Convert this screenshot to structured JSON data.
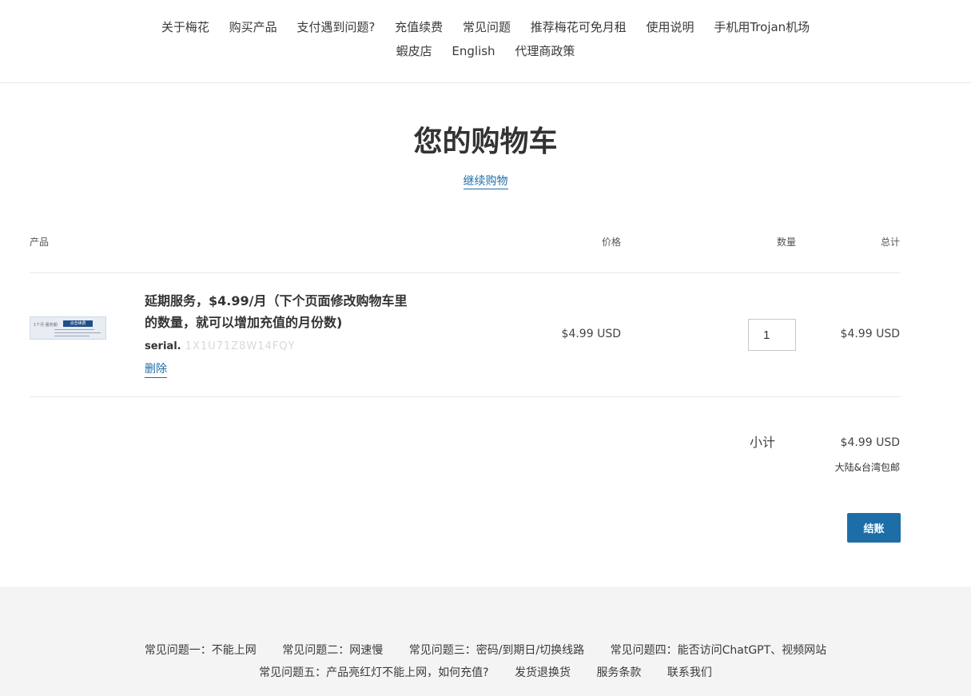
{
  "header": {
    "nav_row1": [
      "关于梅花",
      "购买产品",
      "支付遇到问题?",
      "充值续费",
      "常见问题",
      "推荐梅花可免月租",
      "使用说明",
      "手机用Trojan机场"
    ],
    "nav_row2": [
      "蝦皮店",
      "English",
      "代理商政策"
    ]
  },
  "cart": {
    "title": "您的购物车",
    "continue_shopping": "继续购物",
    "columns": {
      "product": "产品",
      "price": "价格",
      "quantity": "数量",
      "total": "总计"
    },
    "items": [
      {
        "name": "延期服务，$4.99/月（下个页面修改购物车里的数量，就可以增加充值的月份数)",
        "serial_label": "serial.",
        "serial_value_obscured": "  1X1U71Z8W14FQY  ",
        "delete_label": "删除",
        "price": "$4.99 USD",
        "quantity": "1",
        "total": "$4.99 USD",
        "thumbnail": {
          "left_text": "1个月 服务期",
          "bar_text": "点击续费"
        }
      }
    ],
    "subtotal_label": "小计",
    "subtotal_value": "$4.99 USD",
    "shipping_note": "大陆&台湾包邮",
    "checkout_label": "结账"
  },
  "footer": {
    "row1": [
      "常见问题一：不能上网",
      "常见问题二：网速慢",
      "常见问题三：密码/到期日/切换线路",
      "常见问题四：能否访问ChatGPT、视频网站"
    ],
    "row2": [
      "常见问题五：产品亮红灯不能上网，如何充值?",
      "发货退换货",
      "服务条款",
      "联系我们"
    ]
  },
  "colors": {
    "link": "#1d6ea7",
    "button": "#1d6ea7",
    "footer_bg": "#f4f4f4",
    "text": "#333333"
  }
}
